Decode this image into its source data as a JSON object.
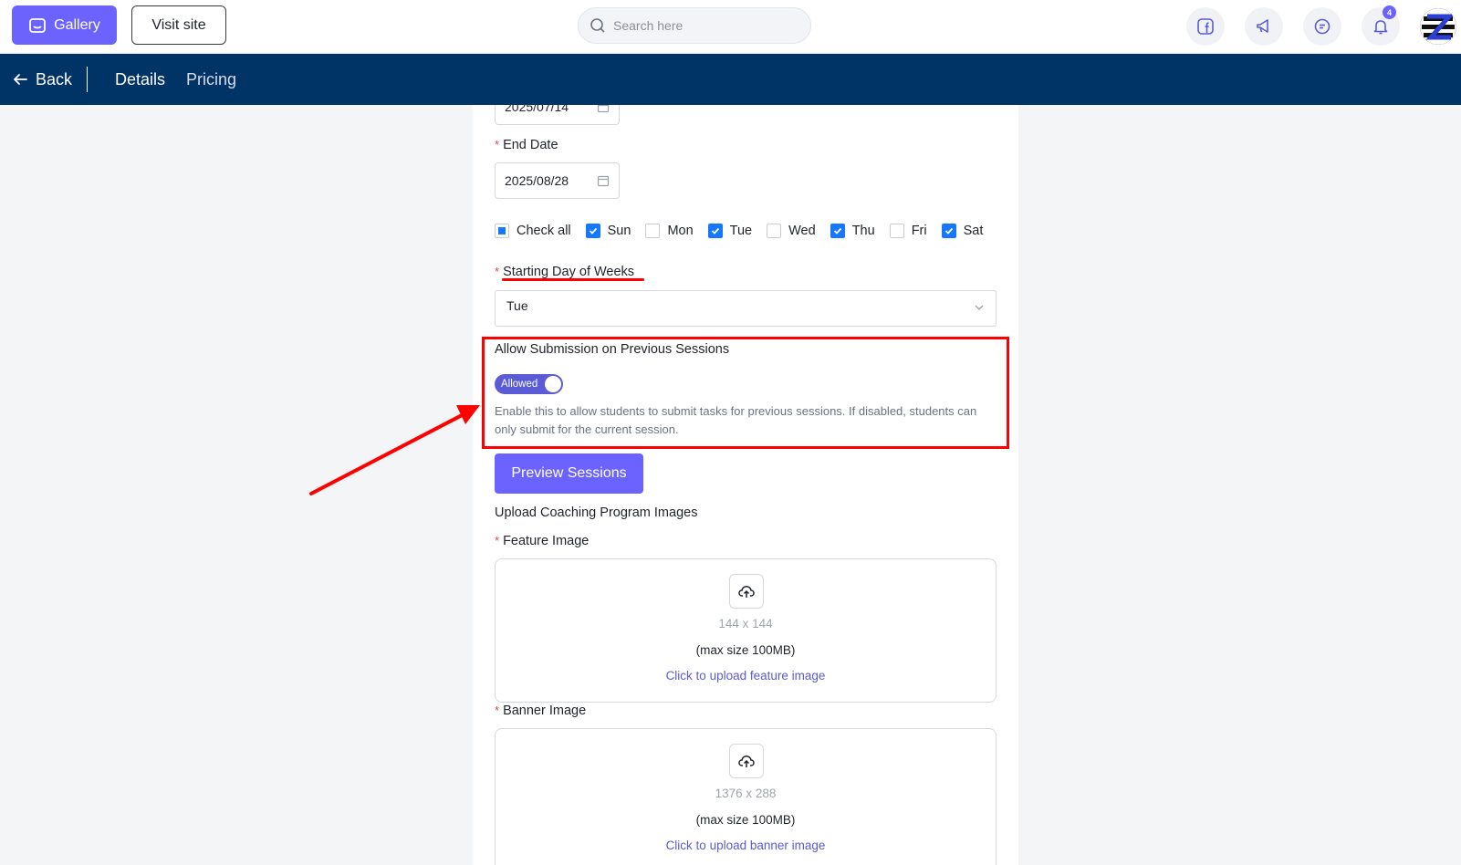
{
  "topbar": {
    "gallery_label": "Gallery",
    "visit_site_label": "Visit site",
    "search_placeholder": "Search here",
    "notification_count": "4"
  },
  "navbar": {
    "back_label": "Back",
    "tabs": [
      "Details",
      "Pricing"
    ]
  },
  "form": {
    "start_date_partial": "2025/07/14",
    "end_date_label": "End Date",
    "end_date_value": "2025/08/28",
    "check_all_label": "Check all",
    "days": [
      {
        "label": "Sun",
        "checked": true
      },
      {
        "label": "Mon",
        "checked": false
      },
      {
        "label": "Tue",
        "checked": true
      },
      {
        "label": "Wed",
        "checked": false
      },
      {
        "label": "Thu",
        "checked": true
      },
      {
        "label": "Fri",
        "checked": false
      },
      {
        "label": "Sat",
        "checked": true
      }
    ],
    "starting_day_label": "Starting Day of Weeks",
    "starting_day_value": "Tue",
    "allow_submission_label": "Allow Submission on Previous Sessions",
    "toggle_label": "Allowed",
    "help_text": "Enable this to allow students to submit tasks for previous sessions. If disabled, students can only submit for the current session.",
    "preview_button": "Preview Sessions",
    "upload_section_title": "Upload Coaching Program Images",
    "feature_image": {
      "label": "Feature Image",
      "dimensions": "144 x 144",
      "max_size": "(max size 100MB)",
      "link": "Click to upload feature image"
    },
    "banner_image": {
      "label": "Banner Image",
      "dimensions": "1376 x 288",
      "max_size": "(max size 100MB)",
      "link": "Click to upload banner image"
    }
  },
  "colors": {
    "accent": "#6c63ff",
    "navbar": "#003366",
    "annotation": "#ff0000",
    "checkbox": "#1677ff"
  }
}
